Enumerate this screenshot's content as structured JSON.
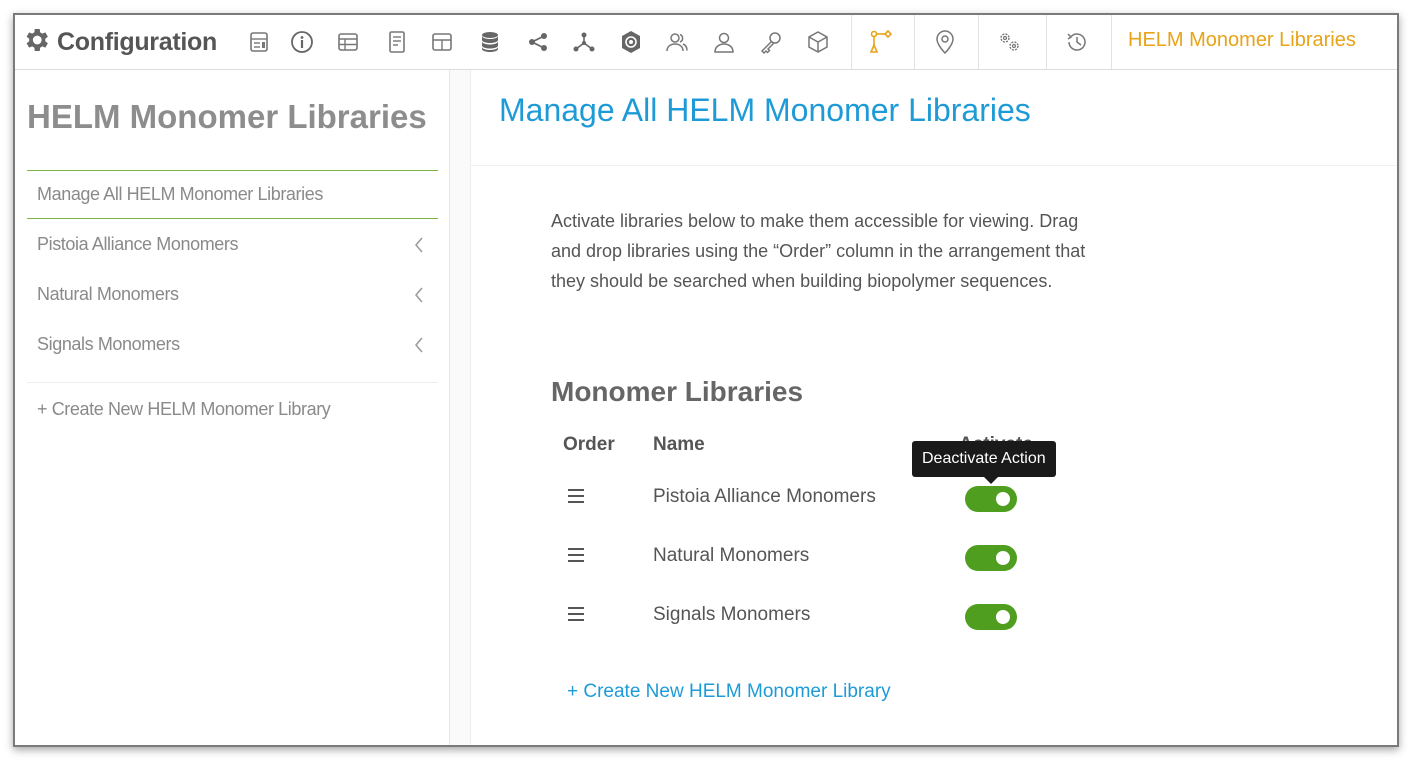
{
  "app": {
    "title": "Configuration"
  },
  "toolbar": {
    "icons": [
      "layout-icon",
      "info-icon",
      "table-icon",
      "document-icon",
      "grid-table-icon",
      "database-icon",
      "share-icon",
      "molecule-icon",
      "badge-icon",
      "users-icon",
      "user-icon",
      "key-icon",
      "cube-icon",
      "helm-icon",
      "location-pin-icon",
      "settings-gears-icon",
      "history-icon"
    ],
    "current_section": "HELM Monomer Libraries",
    "accent_color": "#e8a317",
    "active_icon_color": "#e8a317"
  },
  "sidebar": {
    "title": "HELM Monomer Libraries",
    "items": [
      {
        "label": "Manage All HELM Monomer Libraries",
        "selected": true
      },
      {
        "label": "Pistoia Alliance Monomers",
        "icon": "chevron-left-icon"
      },
      {
        "label": "Natural Monomers",
        "icon": "chevron-left-icon"
      },
      {
        "label": "Signals Monomers",
        "icon": "chevron-left-icon"
      }
    ],
    "create_label": "+ Create New HELM Monomer Library"
  },
  "main": {
    "title": "Manage All HELM Monomer Libraries",
    "title_color": "#1e9bd7",
    "description": "Activate libraries below to make them accessible for viewing. Drag and drop libraries using the “Order” column in the arrangement that they should be searched when building biopolymer sequences.",
    "section_title": "Monomer Libraries",
    "columns": {
      "order": "Order",
      "name": "Name",
      "activate": "Activate"
    },
    "rows": [
      {
        "name": "Pistoia Alliance Monomers",
        "active": true
      },
      {
        "name": "Natural Monomers",
        "active": true
      },
      {
        "name": "Signals Monomers",
        "active": true
      }
    ],
    "toggle_color": "#4f9e20",
    "tooltip": "Deactivate Action",
    "create_link": "+ Create New HELM Monomer Library"
  }
}
